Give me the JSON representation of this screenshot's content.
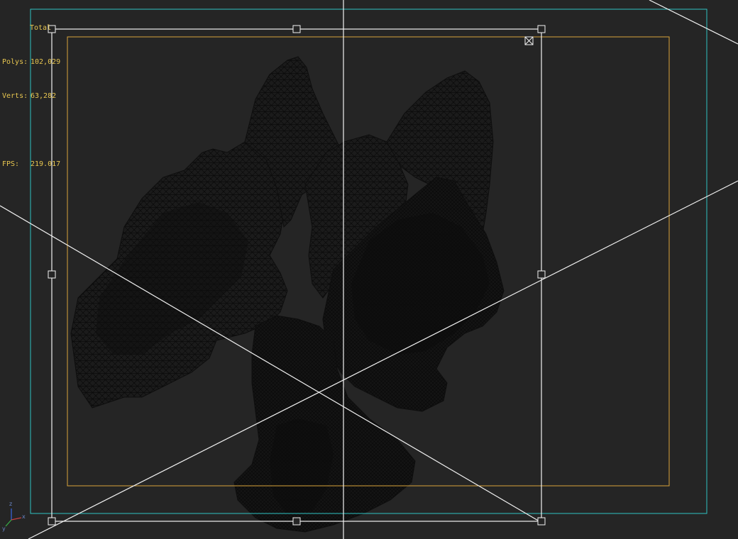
{
  "viewport": {
    "name": "perspective-viewport",
    "background": "#252525",
    "frame_colors": {
      "safe_frame_outer": "#2ec4c4",
      "safe_frame_inner": "#d9a43a",
      "camera_frustum": "#f2f2f2",
      "mesh_wire": "#0d0d0d"
    }
  },
  "stats": {
    "title": "Total",
    "polys_label": "Polys:",
    "polys_value": "102,029",
    "verts_label": "Verts:",
    "verts_value": "63,282",
    "fps_label": "FPS:",
    "fps_value": "219.017"
  },
  "gizmo": {
    "x_label": "x",
    "y_label": "y",
    "z_label": "z"
  }
}
